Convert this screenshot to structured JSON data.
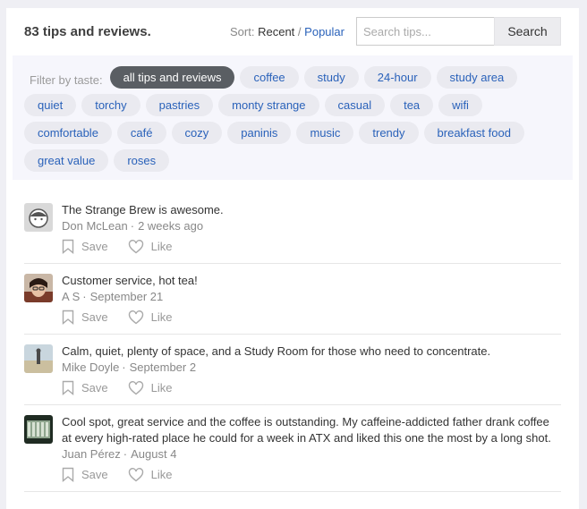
{
  "header": {
    "count_label": "83 tips and reviews.",
    "sort_label": "Sort:",
    "sort_recent": "Recent",
    "sort_separator": "/",
    "sort_popular": "Popular",
    "search_placeholder": "Search tips...",
    "search_button": "Search"
  },
  "filters": {
    "label": "Filter by taste:",
    "tags": [
      "all tips and reviews",
      "coffee",
      "study",
      "24-hour",
      "study area",
      "quiet",
      "torchy",
      "pastries",
      "monty strange",
      "casual",
      "tea",
      "wifi",
      "comfortable",
      "café",
      "cozy",
      "paninis",
      "music",
      "trendy",
      "breakfast food",
      "great value",
      "roses"
    ],
    "active_tag": "all tips and reviews"
  },
  "actions": {
    "save": "Save",
    "like": "Like"
  },
  "tips": [
    {
      "text": "The Strange Brew is awesome.",
      "author": "Don McLean",
      "date": "2 weeks ago",
      "avatar": "placeholder-face-icon"
    },
    {
      "text": "Customer service, hot tea!",
      "author": "A S",
      "date": "September 21",
      "avatar": "user-photo"
    },
    {
      "text": "Calm, quiet, plenty of space, and a Study Room for those who need to concentrate.",
      "author": "Mike Doyle",
      "date": "September 2",
      "avatar": "user-photo"
    },
    {
      "text": "Cool spot, great service and the coffee is outstanding. My caffeine-addicted father drank coffee at every high-rated place he could for a week in ATX and liked this one the most by a long shot.",
      "author": "Juan Pérez",
      "date": "August 4",
      "avatar": "user-photo"
    }
  ],
  "colors": {
    "link": "#2a62ba",
    "active_tag_bg": "#5a5e63",
    "tag_bg": "#eaeaf0",
    "filter_bg": "#f6f6fc",
    "page_bg": "#efeff4"
  }
}
